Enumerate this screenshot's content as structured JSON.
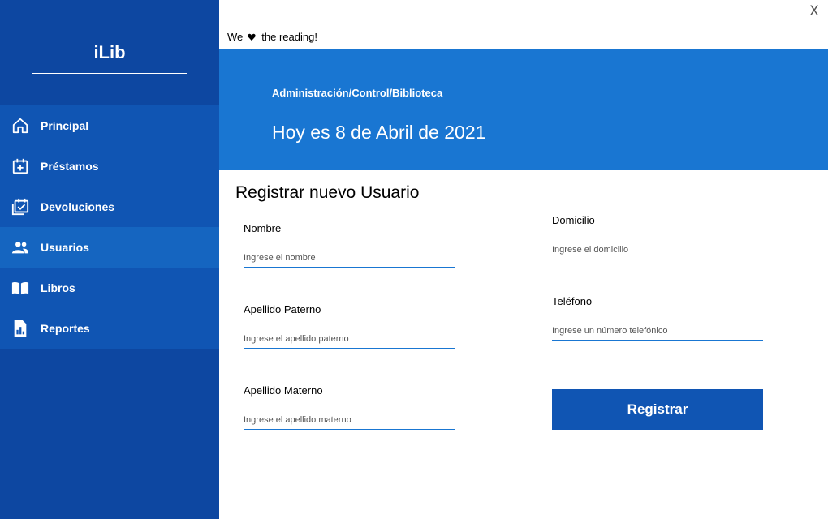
{
  "app": {
    "brand": "iLib",
    "close_label": "X"
  },
  "tagline": {
    "before": "We",
    "icon": "heart-icon",
    "after": "the reading!"
  },
  "sidebar": {
    "items": [
      {
        "label": "Principal",
        "icon": "home-icon",
        "active": false
      },
      {
        "label": "Préstamos",
        "icon": "calendar-add-icon",
        "active": false
      },
      {
        "label": "Devoluciones",
        "icon": "calendar-check-icon",
        "active": false
      },
      {
        "label": "Usuarios",
        "icon": "users-icon",
        "active": true
      },
      {
        "label": "Libros",
        "icon": "book-icon",
        "active": false
      },
      {
        "label": "Reportes",
        "icon": "report-icon",
        "active": false
      }
    ]
  },
  "header": {
    "breadcrumb": "Administración/Control/Biblioteca",
    "date": "Hoy es 8 de Abril de 2021"
  },
  "form": {
    "title": "Registrar nuevo Usuario",
    "fields": {
      "nombre": {
        "label": "Nombre",
        "placeholder": "Ingrese el nombre",
        "value": ""
      },
      "apellido_paterno": {
        "label": "Apellido Paterno",
        "placeholder": "Ingrese el apellido paterno",
        "value": ""
      },
      "apellido_materno": {
        "label": "Apellido Materno",
        "placeholder": "Ingrese el apellido materno",
        "value": ""
      },
      "domicilio": {
        "label": "Domicilio",
        "placeholder": "Ingrese el domicilio",
        "value": ""
      },
      "telefono": {
        "label": "Teléfono",
        "placeholder": "Ingrese un número telefónico",
        "value": ""
      }
    },
    "submit_label": "Registrar"
  },
  "colors": {
    "sidebar": "#0d47a1",
    "sidebar_nav": "#1055b3",
    "active_item": "#1565c0",
    "banner": "#1976d2",
    "button": "#1055b3"
  }
}
